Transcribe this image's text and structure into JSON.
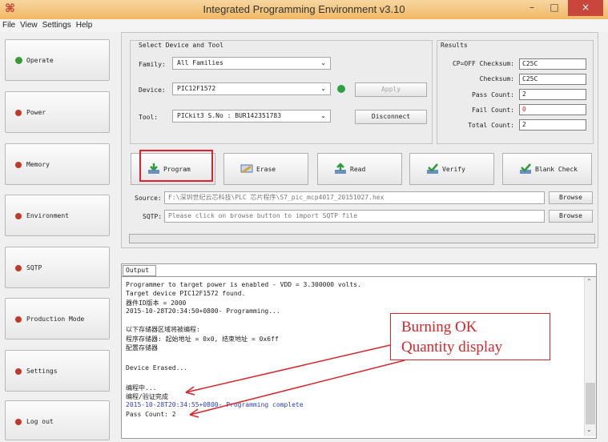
{
  "window": {
    "title": "Integrated Programming Environment v3.10",
    "minimize": "–",
    "maximize": "□",
    "close": "×"
  },
  "menu": [
    "File",
    "View",
    "Settings",
    "Help"
  ],
  "sidebar": [
    {
      "label": "Operate",
      "status": "green"
    },
    {
      "label": "Power",
      "status": "red"
    },
    {
      "label": "Memory",
      "status": "red"
    },
    {
      "label": "Environment",
      "status": "red"
    },
    {
      "label": "SQTP",
      "status": "red"
    },
    {
      "label": "Production Mode",
      "status": "red"
    },
    {
      "label": "Settings",
      "status": "red"
    },
    {
      "label": "Log out",
      "status": "red"
    }
  ],
  "device_tool": {
    "heading": "Select Device and Tool",
    "family_label": "Family:",
    "family_value": "All Families",
    "device_label": "Device:",
    "device_value": "PIC12F1572",
    "apply_label": "Apply",
    "tool_label": "Tool:",
    "tool_value": "PICkit3 S.No : BUR142351783",
    "disconnect_label": "Disconnect"
  },
  "results": {
    "heading": "Results",
    "cp_off_label": "CP=OFF Checksum:",
    "cp_off_value": "C25C",
    "checksum_label": "Checksum:",
    "checksum_value": "C25C",
    "pass_label": "Pass Count:",
    "pass_value": "2",
    "fail_label": "Fail Count:",
    "fail_value": "0",
    "total_label": "Total Count:",
    "total_value": "2"
  },
  "toolbar": [
    {
      "label": "Program"
    },
    {
      "label": "Erase"
    },
    {
      "label": "Read"
    },
    {
      "label": "Verify"
    },
    {
      "label": "Blank Check"
    }
  ],
  "source": {
    "label": "Source:",
    "value": "F:\\深圳世纪云芯科技\\PLC 芯片程序\\S7_pic_mcp4017_20151027.hex",
    "browse": "Browse"
  },
  "sqtp": {
    "label": "SQTP:",
    "placeholder": "Please click on browse button to import SQTP file",
    "browse": "Browse"
  },
  "output": {
    "tab": "Output",
    "lines": [
      "Programmer to target power is enabled - VDD = 3.300000 volts.",
      "Target device PIC12F1572 found.",
      "器件ID版本 = 2000",
      "2015-10-28T20:34:50+0800- Programming...",
      "",
      "以下存储器区域将被编程:",
      "程序存储器: 起始地址 = 0x0, 结束地址 = 0x6ff",
      "配置存储器",
      "",
      "Device Erased...",
      "",
      "编程中...",
      "编程/验证完成",
      "2015-10-28T20:34:55+0800- Programming complete",
      "Pass Count: 2"
    ]
  },
  "annotation": {
    "line1": "Burning OK",
    "line2": "Quantity display"
  }
}
